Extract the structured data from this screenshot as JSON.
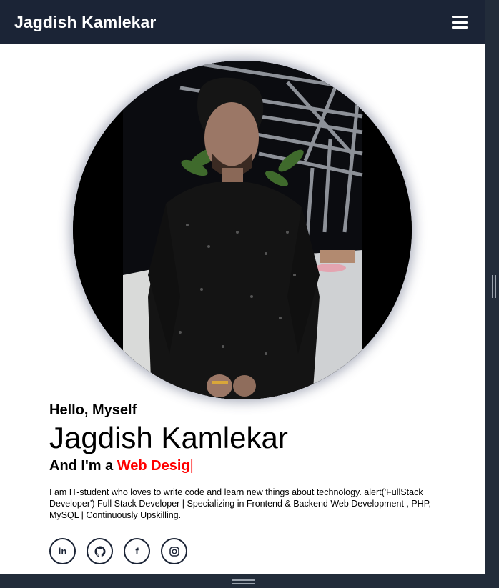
{
  "navbar": {
    "brand": "Jagdish Kamlekar",
    "menu_icon": "hamburger-menu-icon"
  },
  "profile": {
    "image": "profile-photo"
  },
  "intro": {
    "greeting": "Hello, Myself",
    "name": "Jagdish Kamlekar",
    "role_prefix": "And I'm a ",
    "role_typed": "Web Desig",
    "cursor": "|",
    "bio": "I am IT-student who loves to write code and learn new things about technology. alert('FullStack Developer') Full Stack Developer | Specializing in Frontend & Backend Web Development , PHP, MySQL | Continuously Upskilling."
  },
  "socials": [
    {
      "icon": "linkedin-icon",
      "glyph": "in"
    },
    {
      "icon": "github-icon",
      "glyph": ""
    },
    {
      "icon": "facebook-icon",
      "glyph": "f"
    },
    {
      "icon": "instagram-icon",
      "glyph": ""
    }
  ],
  "colors": {
    "navbar_bg": "#1b2436",
    "accent": "#ff0000",
    "text": "#000000",
    "page_bg": "#ffffff"
  }
}
